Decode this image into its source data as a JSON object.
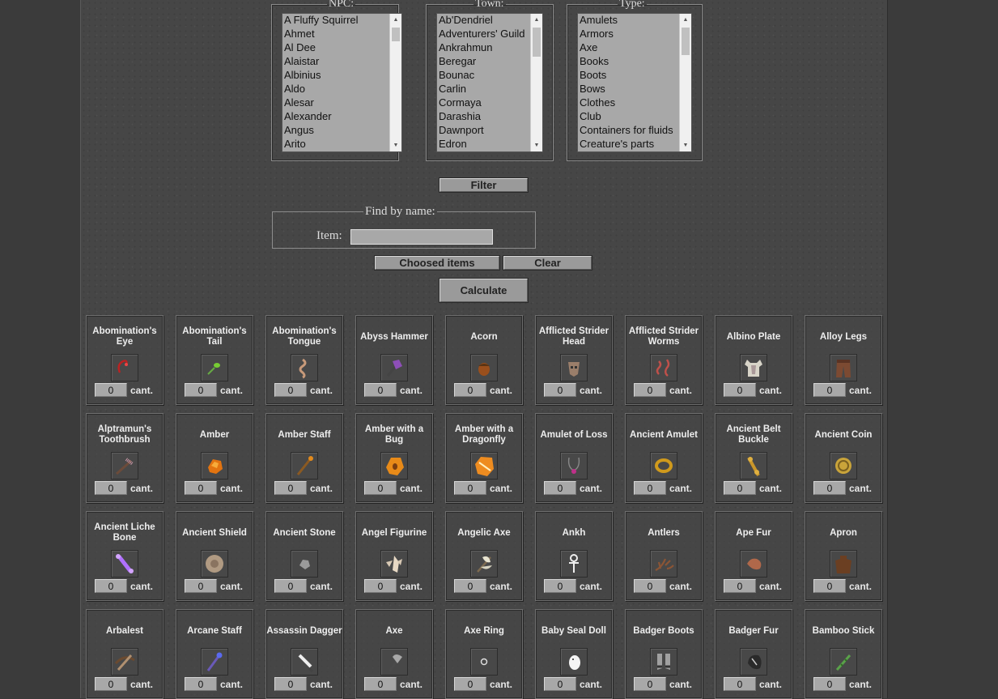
{
  "filters": {
    "npc": {
      "legend": "NPC:",
      "options": [
        "A Fluffy Squirrel",
        "Ahmet",
        "Al Dee",
        "Alaistar",
        "Albinius",
        "Aldo",
        "Alesar",
        "Alexander",
        "Angus",
        "Arito"
      ]
    },
    "town": {
      "legend": "Town:",
      "options": [
        "Ab'Dendriel",
        "Adventurers' Guild",
        "Ankrahmun",
        "Beregar",
        "Bounac",
        "Carlin",
        "Cormaya",
        "Darashia",
        "Dawnport",
        "Edron"
      ]
    },
    "type": {
      "legend": "Type:",
      "options": [
        "Amulets",
        "Armors",
        "Axe",
        "Books",
        "Boots",
        "Bows",
        "Clothes",
        "Club",
        "Containers for fluids",
        "Creature's parts"
      ]
    }
  },
  "buttons": {
    "filter": "Filter",
    "choosed": "Choosed items",
    "clear": "Clear",
    "calculate": "Calculate"
  },
  "finder": {
    "legend": "Find by name:",
    "label": "Item:",
    "value": ""
  },
  "items": [
    {
      "name": "Abomination's Eye",
      "icon": "eye-icon",
      "qty": "0",
      "unit": "cant."
    },
    {
      "name": "Abomination's Tail",
      "icon": "tail-icon",
      "qty": "0",
      "unit": "cant."
    },
    {
      "name": "Abomination's Tongue",
      "icon": "tongue-icon",
      "qty": "0",
      "unit": "cant."
    },
    {
      "name": "Abyss Hammer",
      "icon": "hammer-icon",
      "qty": "0",
      "unit": "cant."
    },
    {
      "name": "Acorn",
      "icon": "acorn-icon",
      "qty": "0",
      "unit": "cant."
    },
    {
      "name": "Afflicted Strider Head",
      "icon": "head-icon",
      "qty": "0",
      "unit": "cant."
    },
    {
      "name": "Afflicted Strider Worms",
      "icon": "worms-icon",
      "qty": "0",
      "unit": "cant."
    },
    {
      "name": "Albino Plate",
      "icon": "plate-armor-icon",
      "qty": "0",
      "unit": "cant."
    },
    {
      "name": "Alloy Legs",
      "icon": "legs-icon",
      "qty": "0",
      "unit": "cant."
    },
    {
      "name": "Alptramun's Toothbrush",
      "icon": "toothbrush-icon",
      "qty": "0",
      "unit": "cant."
    },
    {
      "name": "Amber",
      "icon": "amber-icon",
      "qty": "0",
      "unit": "cant."
    },
    {
      "name": "Amber Staff",
      "icon": "staff-icon",
      "qty": "0",
      "unit": "cant."
    },
    {
      "name": "Amber with a Bug",
      "icon": "amber-bug-icon",
      "qty": "0",
      "unit": "cant."
    },
    {
      "name": "Amber with a Dragonfly",
      "icon": "amber-dragonfly-icon",
      "qty": "0",
      "unit": "cant."
    },
    {
      "name": "Amulet of Loss",
      "icon": "amulet-icon",
      "qty": "0",
      "unit": "cant."
    },
    {
      "name": "Ancient Amulet",
      "icon": "ancient-amulet-icon",
      "qty": "0",
      "unit": "cant."
    },
    {
      "name": "Ancient Belt Buckle",
      "icon": "buckle-icon",
      "qty": "0",
      "unit": "cant."
    },
    {
      "name": "Ancient Coin",
      "icon": "coin-icon",
      "qty": "0",
      "unit": "cant."
    },
    {
      "name": "Ancient Liche Bone",
      "icon": "bone-icon",
      "qty": "0",
      "unit": "cant."
    },
    {
      "name": "Ancient Shield",
      "icon": "shield-icon",
      "qty": "0",
      "unit": "cant."
    },
    {
      "name": "Ancient Stone",
      "icon": "stone-icon",
      "qty": "0",
      "unit": "cant."
    },
    {
      "name": "Angel Figurine",
      "icon": "figurine-icon",
      "qty": "0",
      "unit": "cant."
    },
    {
      "name": "Angelic Axe",
      "icon": "angelic-axe-icon",
      "qty": "0",
      "unit": "cant."
    },
    {
      "name": "Ankh",
      "icon": "ankh-icon",
      "qty": "0",
      "unit": "cant."
    },
    {
      "name": "Antlers",
      "icon": "antlers-icon",
      "qty": "0",
      "unit": "cant."
    },
    {
      "name": "Ape Fur",
      "icon": "fur-icon",
      "qty": "0",
      "unit": "cant."
    },
    {
      "name": "Apron",
      "icon": "apron-icon",
      "qty": "0",
      "unit": "cant."
    },
    {
      "name": "Arbalest",
      "icon": "crossbow-icon",
      "qty": "0",
      "unit": "cant."
    },
    {
      "name": "Arcane Staff",
      "icon": "arcane-staff-icon",
      "qty": "0",
      "unit": "cant."
    },
    {
      "name": "Assassin Dagger",
      "icon": "dagger-icon",
      "qty": "0",
      "unit": "cant."
    },
    {
      "name": "Axe",
      "icon": "axe-icon",
      "qty": "0",
      "unit": "cant."
    },
    {
      "name": "Axe Ring",
      "icon": "ring-icon",
      "qty": "0",
      "unit": "cant."
    },
    {
      "name": "Baby Seal Doll",
      "icon": "seal-doll-icon",
      "qty": "0",
      "unit": "cant."
    },
    {
      "name": "Badger Boots",
      "icon": "boots-icon",
      "qty": "0",
      "unit": "cant."
    },
    {
      "name": "Badger Fur",
      "icon": "badger-fur-icon",
      "qty": "0",
      "unit": "cant."
    },
    {
      "name": "Bamboo Stick",
      "icon": "bamboo-icon",
      "qty": "0",
      "unit": "cant."
    }
  ]
}
